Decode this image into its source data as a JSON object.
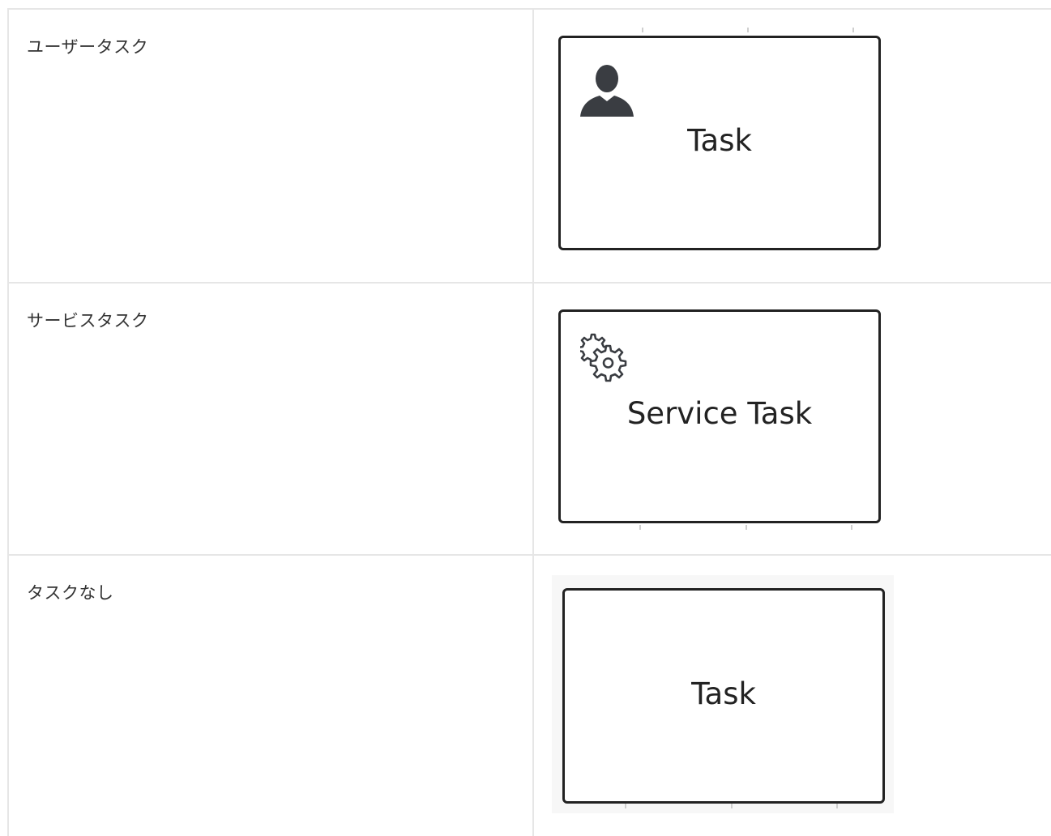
{
  "rows": [
    {
      "label": "ユーザータスク",
      "task_text": "Task",
      "icon": "user-icon"
    },
    {
      "label": "サービスタスク",
      "task_text": "Service Task",
      "icon": "gear-icon"
    },
    {
      "label": "タスクなし",
      "task_text": "Task",
      "icon": ""
    }
  ],
  "colors": {
    "border": "#e6e6e6",
    "task_stroke": "#222222",
    "icon_fill": "#3a3d42"
  }
}
